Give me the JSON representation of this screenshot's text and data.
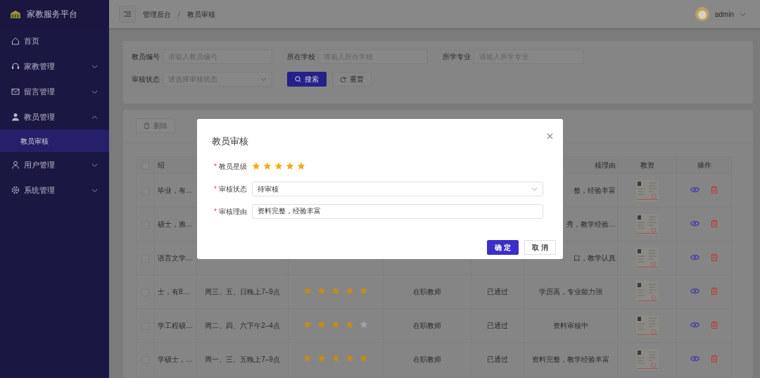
{
  "app": {
    "title": "家教服务平台"
  },
  "sidebar": {
    "items": [
      {
        "label": "首页",
        "kind": "link"
      },
      {
        "label": "家教管理",
        "kind": "group",
        "expanded": false
      },
      {
        "label": "留言管理",
        "kind": "group",
        "expanded": false
      },
      {
        "label": "教员管理",
        "kind": "group",
        "expanded": true,
        "children": [
          {
            "label": "教员审核",
            "selected": true
          }
        ]
      },
      {
        "label": "用户管理",
        "kind": "group",
        "expanded": false
      },
      {
        "label": "系统管理",
        "kind": "group",
        "expanded": false
      }
    ]
  },
  "header": {
    "breadcrumb": [
      "管理后台",
      "教员审核"
    ],
    "separator": "/",
    "user": "admin"
  },
  "search_form": {
    "fields": [
      {
        "label": "教员编号",
        "placeholder": "请输入教员编号",
        "kind": "input"
      },
      {
        "label": "所在学校",
        "placeholder": "请输入所在学校",
        "kind": "input"
      },
      {
        "label": "所学专业",
        "placeholder": "请输入所学专业",
        "kind": "input"
      },
      {
        "label": "审核状态",
        "placeholder": "请选择审核状态",
        "kind": "select"
      }
    ],
    "buttons": [
      {
        "label": "搜索",
        "kind": "primary"
      },
      {
        "label": "重置",
        "kind": "default"
      }
    ]
  },
  "toolbar": {
    "delete_button": "删除"
  },
  "table": {
    "all_selected": false,
    "columns": [
      "绍",
      "核理由",
      "教资",
      "操作"
    ],
    "rows": [
      {
        "selected": false,
        "intro": "毕业，有…",
        "reason": "整，经验丰富"
      },
      {
        "selected": false,
        "intro": "硕士，雅…",
        "reason": "秀，教学经验…"
      },
      {
        "selected": false,
        "intro": "语言文学…",
        "reason": "口，教学认真"
      },
      {
        "selected": false,
        "intro": "士，有8…",
        "time": "周三、五、日晚上7–9点",
        "stars": 5,
        "job": "在职教师",
        "status": "已通过",
        "reason": "学历高，专业能力强"
      },
      {
        "selected": false,
        "intro": "学工程硕…",
        "time": "周二、四、六下午2–4点",
        "stars": 4,
        "job": "在职教师",
        "status": "已通过",
        "reason": "资料审核中"
      },
      {
        "selected": false,
        "intro": "学硕士，…",
        "time": "周一、三、五晚上7–9点",
        "stars": 5,
        "job": "在职教师",
        "status": "已通过",
        "reason": "资料完整，教学经验丰富"
      }
    ]
  },
  "modal": {
    "title": "教员审核",
    "required_mark": "*",
    "fields": [
      {
        "label": "教员星级",
        "required": true,
        "kind": "rating",
        "stars": 5
      },
      {
        "label": "审核状态",
        "required": true,
        "kind": "select",
        "value": "待审核"
      },
      {
        "label": "审核理由",
        "required": true,
        "kind": "input",
        "value": "资料完整，经验丰富"
      }
    ],
    "buttons": [
      {
        "label": "确 定",
        "kind": "primary"
      },
      {
        "label": "取 消",
        "kind": "default"
      }
    ]
  }
}
